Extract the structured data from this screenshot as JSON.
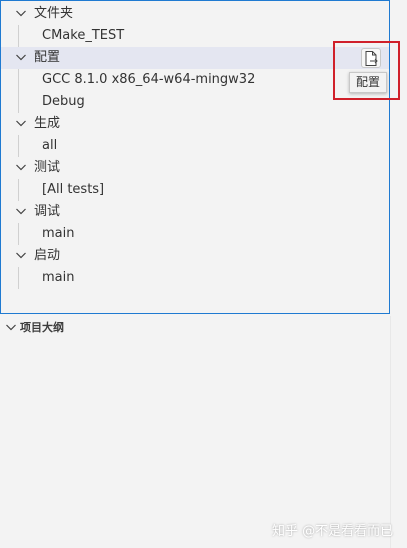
{
  "tree": {
    "folder": {
      "label": "文件夹",
      "child": "CMake_TEST"
    },
    "configure": {
      "label": "配置",
      "children": [
        "GCC 8.1.0 x86_64-w64-mingw32",
        "Debug"
      ],
      "action_icon": "file-export-icon",
      "tooltip": "配置"
    },
    "build": {
      "label": "生成",
      "child": "all"
    },
    "test": {
      "label": "测试",
      "child": "[All tests]"
    },
    "debug": {
      "label": "调试",
      "child": "main"
    },
    "launch": {
      "label": "启动",
      "child": "main"
    }
  },
  "outline": {
    "title": "项目大纲"
  },
  "watermark": "知乎 @不是看看而已",
  "colors": {
    "focus_border": "#1f7ad1",
    "selected_row": "#e4e6f1",
    "highlight_box": "#d0202a",
    "panel_bg": "#f3f3f3"
  }
}
